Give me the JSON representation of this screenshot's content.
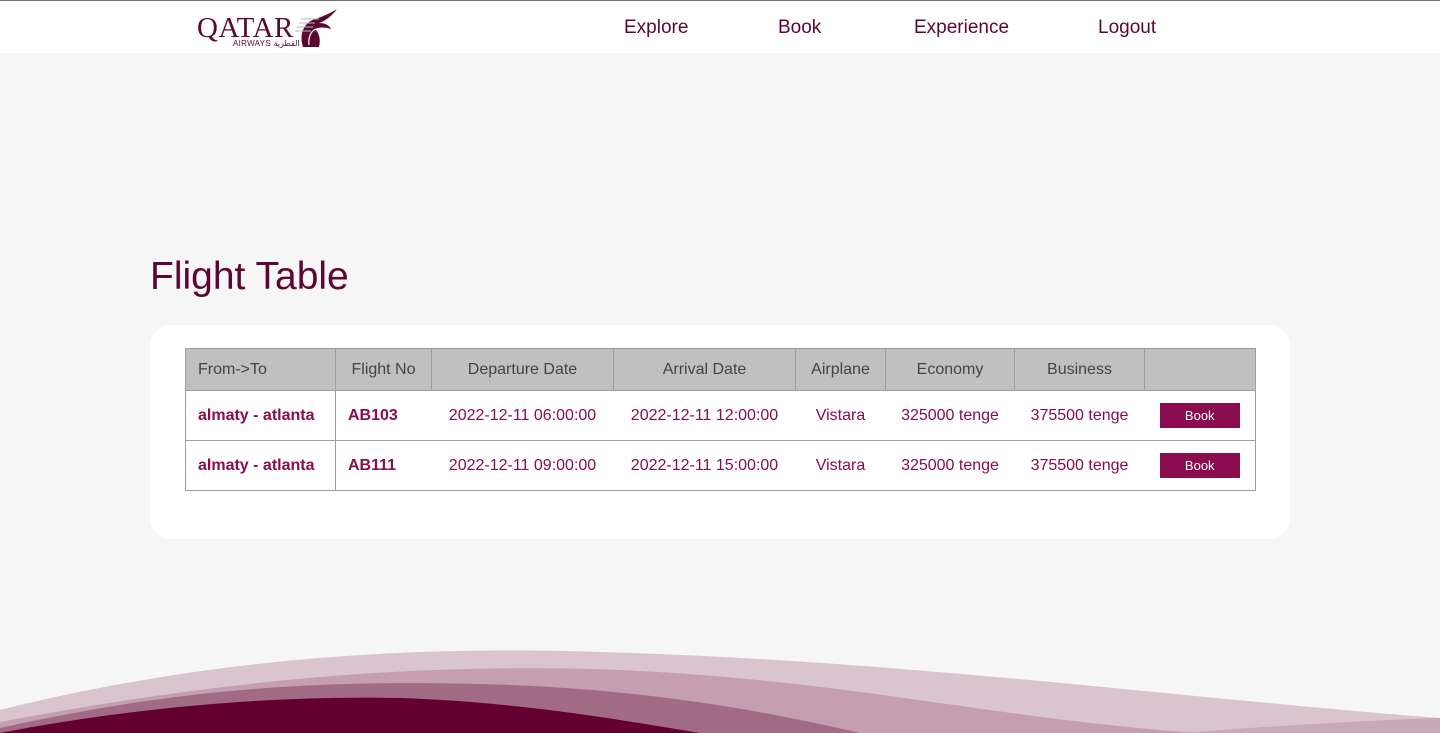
{
  "brand": {
    "logo_text": "QATAR",
    "logo_subtext": "AIRWAYS القطرية",
    "color": "#5c0632",
    "accent": "#8a0b4e"
  },
  "nav": {
    "items": [
      {
        "label": "Explore"
      },
      {
        "label": "Book"
      },
      {
        "label": "Experience"
      },
      {
        "label": "Logout"
      }
    ]
  },
  "page": {
    "title": "Flight Table"
  },
  "table": {
    "headers": [
      "From->To",
      "Flight No",
      "Departure Date",
      "Arrival Date",
      "Airplane",
      "Economy",
      "Business",
      ""
    ],
    "rows": [
      {
        "route": "almaty - atlanta",
        "flight_no": "AB103",
        "departure": "2022-12-11 06:00:00",
        "arrival": "2022-12-11 12:00:00",
        "airplane": "Vistara",
        "economy": "325000 tenge",
        "business": "375500 tenge",
        "action": "Book"
      },
      {
        "route": "almaty - atlanta",
        "flight_no": "AB111",
        "departure": "2022-12-11 09:00:00",
        "arrival": "2022-12-11 15:00:00",
        "airplane": "Vistara",
        "economy": "325000 tenge",
        "business": "375500 tenge",
        "action": "Book"
      }
    ]
  }
}
